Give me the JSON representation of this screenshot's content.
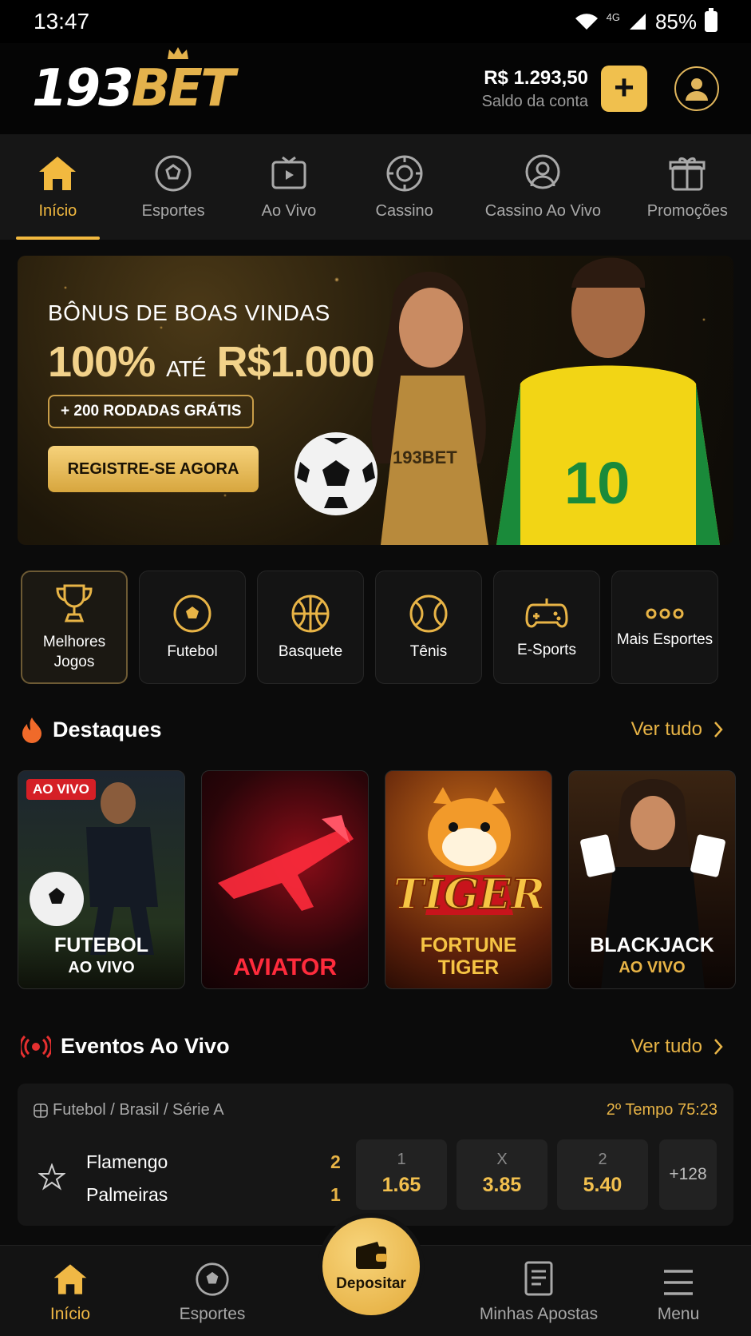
{
  "status_bar": {
    "time": "13:47",
    "network": "4G",
    "battery": "85%"
  },
  "header": {
    "logo_numbers": "193",
    "logo_brand": "BET",
    "balance_amount": "R$ 1.293,50",
    "balance_label": "Saldo da conta"
  },
  "top_nav": [
    {
      "label": "Início",
      "icon": "home-icon",
      "active": true
    },
    {
      "label": "Esportes",
      "icon": "soccer-ball-icon"
    },
    {
      "label": "Ao Vivo",
      "icon": "live-tv-icon"
    },
    {
      "label": "Cassino",
      "icon": "casino-chip-icon"
    },
    {
      "label": "Cassino Ao Vivo",
      "icon": "live-dealer-icon"
    },
    {
      "label": "Promoções",
      "icon": "gift-icon"
    }
  ],
  "banner": {
    "title": "BÔNUS DE BOAS VINDAS",
    "percent": "100%",
    "until": "ATÉ",
    "amount": "R$1.000",
    "spins": "+ 200 RODADAS GRÁTIS",
    "cta": "REGISTRE-SE AGORA",
    "jersey_number": "10",
    "dress_logo": "193BET"
  },
  "categories": [
    {
      "label": "Melhores Jogos",
      "icon": "trophy-icon",
      "active": true
    },
    {
      "label": "Futebol",
      "icon": "soccer-ball-icon"
    },
    {
      "label": "Basquete",
      "icon": "basketball-icon"
    },
    {
      "label": "Tênis",
      "icon": "tennis-ball-icon"
    },
    {
      "label": "E-Sports",
      "icon": "gamepad-icon"
    },
    {
      "label": "Mais Esportes",
      "icon": "more-dots-icon"
    }
  ],
  "highlights": {
    "title": "Destaques",
    "see_all": "Ver tudo",
    "games": [
      {
        "line1": "FUTEBOL",
        "line2": "AO VIVO",
        "badge": "AO VIVO"
      },
      {
        "line1": "AVIATOR",
        "line2": ""
      },
      {
        "line1": "FORTUNE",
        "line2": "TIGER",
        "art_text": "TIGER"
      },
      {
        "line1": "BLACKJACK",
        "line2": "AO VIVO"
      }
    ]
  },
  "live_events": {
    "title": "Eventos Ao Vivo",
    "see_all": "Ver tudo",
    "event": {
      "breadcrumb": "Futebol / Brasil / Série A",
      "clock": "2º Tempo 75:23",
      "home_team": "Flamengo",
      "away_team": "Palmeiras",
      "home_score": "2",
      "away_score": "1",
      "odds": [
        {
          "key": "1",
          "value": "1.65"
        },
        {
          "key": "X",
          "value": "3.85"
        },
        {
          "key": "2",
          "value": "5.40"
        }
      ],
      "more_markets": "+128"
    }
  },
  "bottom_nav": {
    "home": "Início",
    "sports": "Esportes",
    "deposit": "Depositar",
    "my_bets": "Minhas Apostas",
    "menu": "Menu"
  },
  "colors": {
    "accent": "#f2b93f",
    "background": "#0b0b0b",
    "live_red": "#d51f26"
  }
}
